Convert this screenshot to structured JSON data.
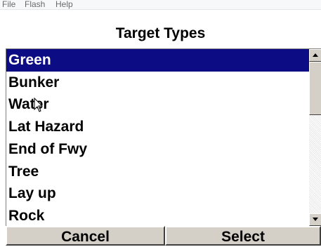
{
  "menu": {
    "items": [
      "File",
      "Flash",
      "Help"
    ]
  },
  "title": "Target Types",
  "list": {
    "items": [
      {
        "label": "Green",
        "selected": true
      },
      {
        "label": "Bunker",
        "selected": false
      },
      {
        "label": "Water",
        "selected": false
      },
      {
        "label": "Lat Hazard",
        "selected": false
      },
      {
        "label": "End of Fwy",
        "selected": false
      },
      {
        "label": "Tree",
        "selected": false
      },
      {
        "label": "Lay up",
        "selected": false
      },
      {
        "label": "Rock",
        "selected": false
      }
    ]
  },
  "buttons": {
    "cancel": "Cancel",
    "select": "Select"
  },
  "icons": {
    "scroll_up": "scroll-up-arrow-icon",
    "scroll_down": "scroll-down-arrow-icon",
    "cursor": "mouse-pointer-icon"
  },
  "colors": {
    "selection": "#0c0c84",
    "button_face": "#d4d0c8"
  }
}
